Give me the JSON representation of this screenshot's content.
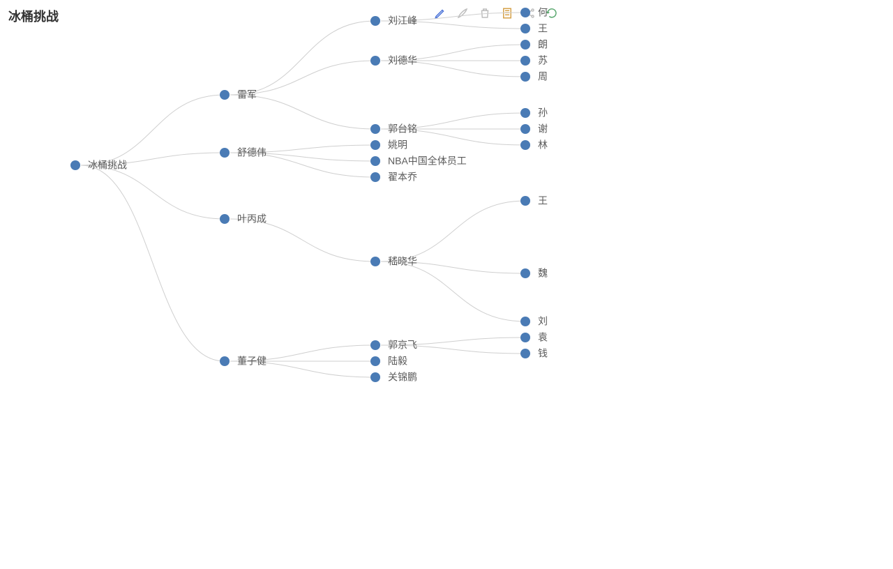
{
  "title": "冰桶挑战",
  "tree": {
    "label": "冰桶挑战",
    "children": [
      {
        "label": "雷军",
        "children": [
          {
            "label": "刘江峰",
            "children": [
              {
                "label": "何"
              },
              {
                "label": "王"
              }
            ]
          },
          {
            "label": "刘德华",
            "children": [
              {
                "label": "朗"
              },
              {
                "label": "苏"
              },
              {
                "label": "周"
              }
            ]
          },
          {
            "label": "郭台铭",
            "children": [
              {
                "label": "孙"
              },
              {
                "label": "谢"
              },
              {
                "label": "林"
              }
            ]
          }
        ]
      },
      {
        "label": "舒德伟",
        "children": [
          {
            "label": "姚明"
          },
          {
            "label": "NBA中国全体员工"
          },
          {
            "label": "翟本乔"
          }
        ]
      },
      {
        "label": "叶丙成",
        "children": [
          {
            "label": "嵇晓华",
            "children": [
              {
                "label": "王"
              },
              {
                "label": "魏"
              },
              {
                "label": "刘"
              }
            ]
          }
        ]
      },
      {
        "label": "董子健",
        "children": [
          {
            "label": "郭京飞",
            "children": [
              {
                "label": "袁"
              },
              {
                "label": "钱"
              }
            ]
          },
          {
            "label": "陆毅"
          },
          {
            "label": "关锦鹏"
          }
        ]
      }
    ]
  },
  "toolbar": {
    "edit": "edit",
    "brush": "brush",
    "trash": "trash",
    "note": "note",
    "share": "share",
    "refresh": "refresh"
  },
  "colors": {
    "dot": "#4a7bb5",
    "edge": "#cfcfcf",
    "title": "#333333",
    "label": "#5a5a5a"
  }
}
